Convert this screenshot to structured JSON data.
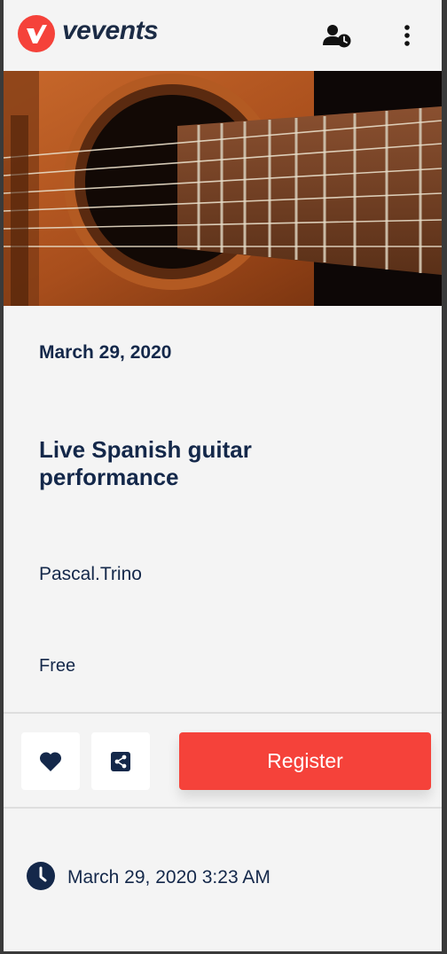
{
  "brand": {
    "name": "vevents",
    "logo_color": "#f5423a",
    "text_color": "#1b2b45"
  },
  "header": {
    "profile_icon": "user-clock-icon",
    "menu_icon": "more-vertical-icon"
  },
  "event": {
    "date": "March 29, 2020",
    "title": "Live Spanish guitar performance",
    "organizer": "Pascal.Trino",
    "price": "Free",
    "datetime": "March 29, 2020 3:23 AM",
    "image": "acoustic-guitar-photo"
  },
  "actions": {
    "like_icon": "heart-icon",
    "share_icon": "share-icon",
    "register_label": "Register",
    "register_color": "#f5423a"
  },
  "details": {
    "time_icon": "clock-icon"
  }
}
